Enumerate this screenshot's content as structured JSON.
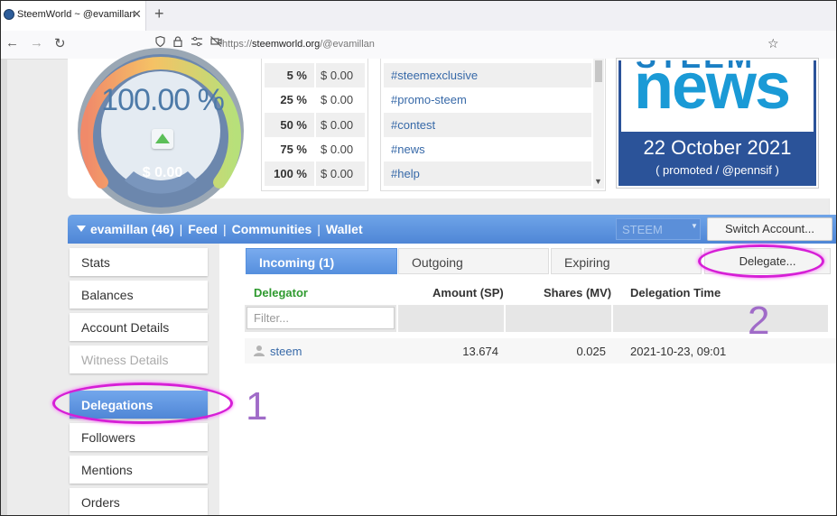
{
  "browser": {
    "tab_title": "SteemWorld ~ @evamillan",
    "url_prefix": "https://",
    "url_domain": "steemworld.org",
    "url_path": "/@evamillan"
  },
  "gauge": {
    "value": "100.00 %",
    "money": "$ 0.00",
    "level": 1.0
  },
  "vote_values": [
    {
      "pct": "5 %",
      "usd": "$ 0.00"
    },
    {
      "pct": "25 %",
      "usd": "$ 0.00"
    },
    {
      "pct": "50 %",
      "usd": "$ 0.00"
    },
    {
      "pct": "75 %",
      "usd": "$ 0.00"
    },
    {
      "pct": "100 %",
      "usd": "$ 0.00"
    }
  ],
  "tags": [
    "#steemexclusive",
    "#promo-steem",
    "#contest",
    "#news",
    "#help"
  ],
  "news_banner": {
    "top_text": "STEEM",
    "word": "news",
    "date": "22 October 2021",
    "sub": "( promoted / @pennsif )"
  },
  "account_bar": {
    "account": "evamillan (46)",
    "sep": "|",
    "links": [
      "Feed",
      "Communities",
      "Wallet"
    ],
    "coin": "STEEM",
    "switch": "Switch Account..."
  },
  "sidebar": [
    "Stats",
    "Balances",
    "Account Details",
    "Witness Details",
    "Delegations",
    "Followers",
    "Mentions",
    "Orders"
  ],
  "delegation_tabs": [
    "Incoming (1)",
    "Outgoing",
    "Expiring"
  ],
  "delegate_button": "Delegate...",
  "columns": {
    "delegator": "Delegator",
    "amount": "Amount (SP)",
    "shares": "Shares (MV)",
    "time": "Delegation Time"
  },
  "filter_placeholder": "Filter...",
  "rows": [
    {
      "delegator": "steem",
      "amount": "13.674",
      "shares": "0.025",
      "time": "2021-10-23, 09:01"
    }
  ],
  "annotations": {
    "one": "1",
    "two": "2"
  },
  "colors": {
    "accent_blue": "#4f86d6",
    "highlight": "#d61fd6",
    "delegator_green": "#2f9a2f"
  }
}
